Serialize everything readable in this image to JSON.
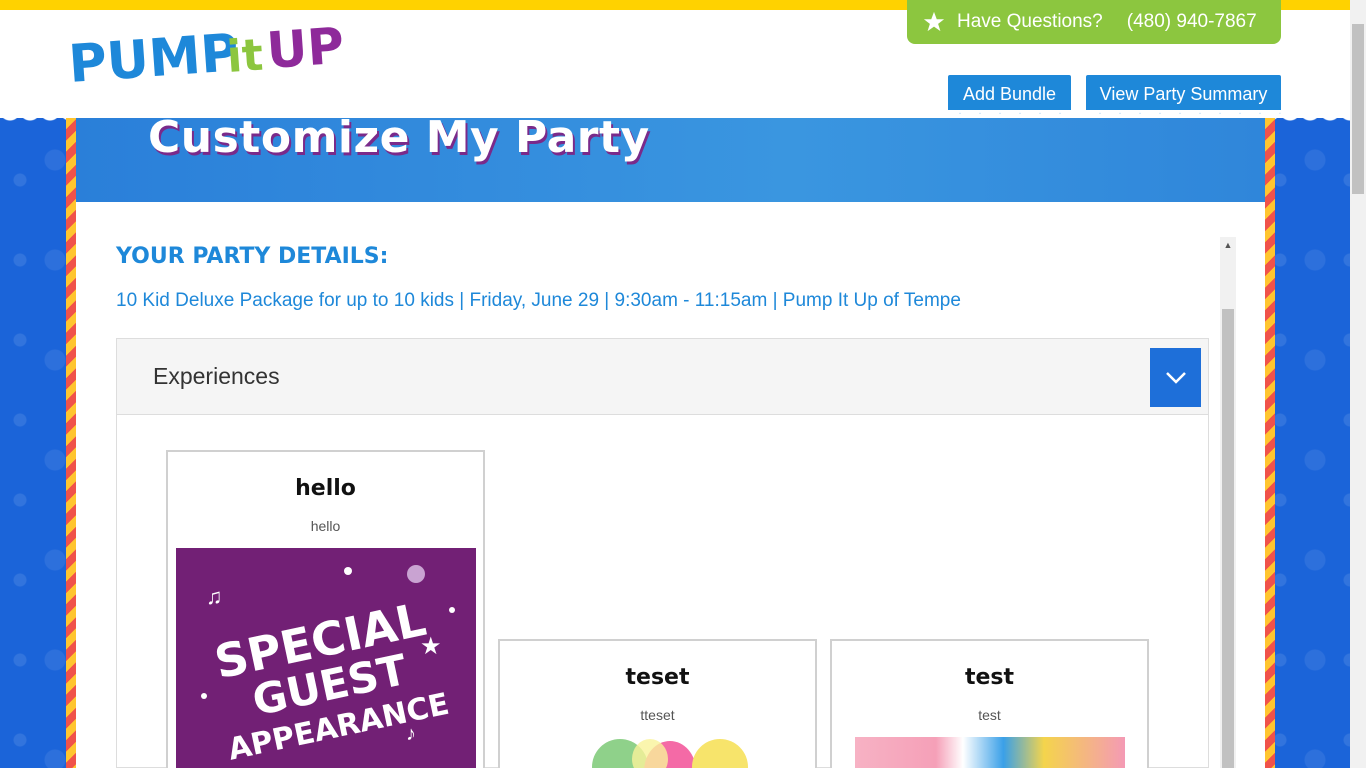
{
  "brand": {
    "logo_text_pump": "PUMP",
    "logo_text_it": "it",
    "logo_text_up": "UP"
  },
  "header": {
    "questions_label": "Have Questions?",
    "phone": "(480) 940-7867",
    "add_bundle_label": "Add Bundle",
    "view_summary_label": "View Party Summary"
  },
  "page": {
    "title": "Customize My Party"
  },
  "party_details": {
    "heading": "YOUR PARTY DETAILS:",
    "summary": "10 Kid Deluxe Package for up to 10 kids | Friday, June 29 | 9:30am - 11:15am | Pump It Up of Tempe"
  },
  "accordion": {
    "title": "Experiences",
    "expanded": true
  },
  "cards": [
    {
      "title": "hello",
      "subtitle": "hello",
      "image_text": [
        "SPECIAL",
        "GUEST",
        "APPEARANCE"
      ]
    },
    {
      "title": "teset",
      "subtitle": "tteset",
      "image": "balloons"
    },
    {
      "title": "test",
      "subtitle": "test",
      "image": "party-decorations"
    }
  ],
  "colors": {
    "brand_blue": "#1e88d9",
    "accent_green": "#8cc63f",
    "header_yellow": "#ffd200",
    "title_shadow_purple": "#7a2a8a",
    "card_image_purple": "#722075"
  }
}
